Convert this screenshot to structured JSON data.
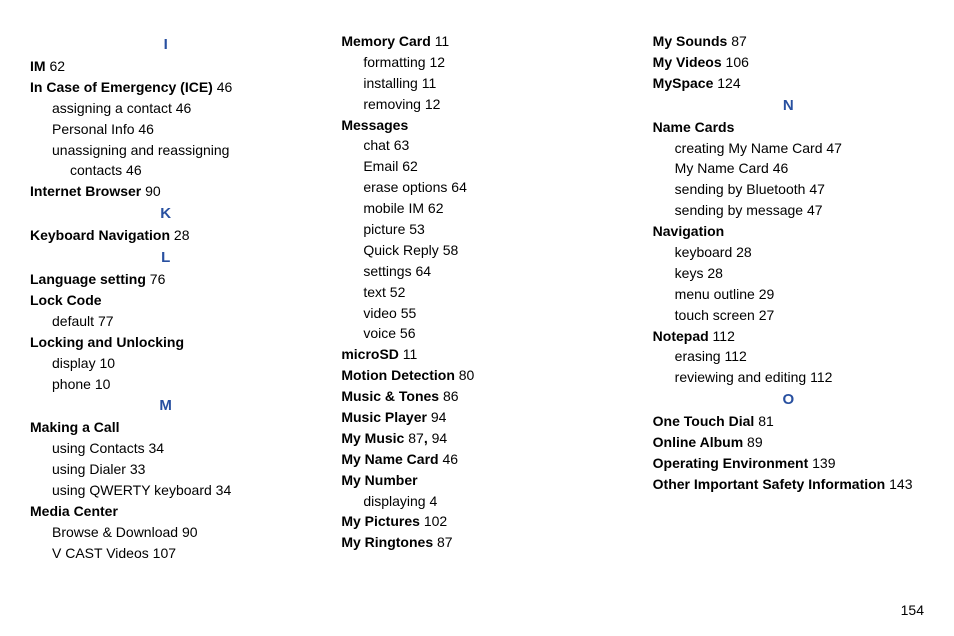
{
  "pageNumber": "154",
  "columns": {
    "c1": {
      "letters": {
        "I": {
          "label": "I"
        },
        "K": {
          "label": "K"
        },
        "L": {
          "label": "L"
        },
        "M": {
          "label": "M"
        }
      },
      "items": {
        "im": {
          "term": "IM",
          "page": "62"
        },
        "ice": {
          "term": "In Case of Emergency (ICE)",
          "page": "46"
        },
        "ice_assign": {
          "term": "assigning a contact",
          "page": "46"
        },
        "ice_personal": {
          "term": "Personal Info",
          "page": "46"
        },
        "ice_unassign1": {
          "term": "unassigning and reassigning"
        },
        "ice_unassign2": {
          "term": "contacts",
          "page": "46"
        },
        "browser": {
          "term": "Internet Browser",
          "page": "90"
        },
        "keyboard_nav": {
          "term": "Keyboard Navigation",
          "page": "28"
        },
        "lang": {
          "term": "Language setting",
          "page": "76"
        },
        "lockcode": {
          "term": "Lock Code"
        },
        "lockcode_default": {
          "term": "default",
          "page": "77"
        },
        "lockunlock": {
          "term": "Locking and Unlocking"
        },
        "lockunlock_display": {
          "term": "display",
          "page": "10"
        },
        "lockunlock_phone": {
          "term": "phone",
          "page": "10"
        },
        "makingcall": {
          "term": "Making a Call"
        },
        "mc_contacts": {
          "term": "using Contacts",
          "page": "34"
        },
        "mc_dialer": {
          "term": "using Dialer",
          "page": "33"
        },
        "mc_qwerty": {
          "term": "using QWERTY keyboard",
          "page": "34"
        },
        "mediacenter": {
          "term": "Media Center"
        },
        "mc_browse": {
          "term": "Browse & Download",
          "page": "90"
        },
        "mc_vcast": {
          "term": "V CAST Videos",
          "page": "107"
        }
      }
    },
    "c2": {
      "items": {
        "memcard": {
          "term": "Memory Card",
          "page": "11"
        },
        "memcard_format": {
          "term": "formatting",
          "page": "12"
        },
        "memcard_install": {
          "term": "installing",
          "page": "11"
        },
        "memcard_remove": {
          "term": "removing",
          "page": "12"
        },
        "messages": {
          "term": "Messages"
        },
        "msg_chat": {
          "term": "chat",
          "page": "63"
        },
        "msg_email": {
          "term": "Email",
          "page": "62"
        },
        "msg_erase": {
          "term": "erase options",
          "page": "64"
        },
        "msg_mobileim": {
          "term": "mobile IM",
          "page": "62"
        },
        "msg_picture": {
          "term": "picture",
          "page": "53"
        },
        "msg_quickreply": {
          "term": "Quick Reply",
          "page": "58"
        },
        "msg_settings": {
          "term": "settings",
          "page": "64"
        },
        "msg_text": {
          "term": "text",
          "page": "52"
        },
        "msg_video": {
          "term": "video",
          "page": "55"
        },
        "msg_voice": {
          "term": "voice",
          "page": "56"
        },
        "microsd": {
          "term": "microSD",
          "page": "11"
        },
        "motion": {
          "term": "Motion Detection",
          "page": "80"
        },
        "musictones": {
          "term": "Music & Tones",
          "page": "86"
        },
        "musicplayer": {
          "term": "Music Player",
          "page": "94"
        },
        "mymusic": {
          "term": "My Music",
          "page1": "87",
          "comma": ", ",
          "page2": "94"
        },
        "mynamecard": {
          "term": "My Name Card",
          "page": "46"
        },
        "mynumber": {
          "term": "My Number"
        },
        "mynumber_disp": {
          "term": "displaying",
          "page": "4"
        },
        "mypictures": {
          "term": "My Pictures",
          "page": "102"
        },
        "myringtones": {
          "term": "My Ringtones",
          "page": "87"
        }
      }
    },
    "c3": {
      "letters": {
        "N": {
          "label": "N"
        },
        "O": {
          "label": "O"
        }
      },
      "items": {
        "mysounds": {
          "term": "My Sounds",
          "page": "87"
        },
        "myvideos": {
          "term": "My Videos",
          "page": "106"
        },
        "myspace": {
          "term": "MySpace",
          "page": "124"
        },
        "namecards": {
          "term": "Name Cards"
        },
        "nc_create": {
          "term": "creating My Name Card",
          "page": "47"
        },
        "nc_mynamecard": {
          "term": "My Name Card",
          "page": "46"
        },
        "nc_bluetooth": {
          "term": "sending by Bluetooth",
          "page": "47"
        },
        "nc_message": {
          "term": "sending by message",
          "page": "47"
        },
        "navigation": {
          "term": "Navigation"
        },
        "nav_keyboard": {
          "term": "keyboard",
          "page": "28"
        },
        "nav_keys": {
          "term": "keys",
          "page": "28"
        },
        "nav_menu": {
          "term": "menu outline",
          "page": "29"
        },
        "nav_touch": {
          "term": "touch screen",
          "page": "27"
        },
        "notepad": {
          "term": "Notepad",
          "page": "112"
        },
        "notepad_erase": {
          "term": "erasing",
          "page": "112"
        },
        "notepad_review": {
          "term": "reviewing and editing",
          "page": "112"
        },
        "onetouch": {
          "term": "One Touch Dial",
          "page": "81"
        },
        "onlinealbum": {
          "term": "Online Album",
          "page": "89"
        },
        "openv": {
          "term": "Operating Environment",
          "page": "139"
        },
        "othersafety": {
          "term": "Other Important Safety Information",
          "page": "143"
        }
      }
    }
  }
}
